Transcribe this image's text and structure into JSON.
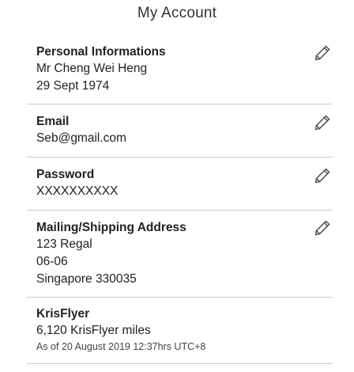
{
  "header": {
    "title": "My Account"
  },
  "personal": {
    "heading": "Personal Informations",
    "name": "Mr Cheng Wei Heng",
    "dob": "29 Sept 1974",
    "edit_icon": "pencil-icon"
  },
  "email": {
    "heading": "Email",
    "value": "Seb@gmail.com",
    "edit_icon": "pencil-icon"
  },
  "password": {
    "heading": "Password",
    "value": "XXXXXXXXXX",
    "edit_icon": "pencil-icon"
  },
  "address": {
    "heading": "Mailing/Shipping Address",
    "lines": [
      "123 Regal",
      "06-06",
      "Singapore 330035"
    ],
    "edit_icon": "pencil-icon"
  },
  "krisflyer": {
    "heading": "KrisFlyer",
    "miles": "6,120 KrisFlyer miles",
    "as_of": "As of 20 August 2019 12:37hrs UTC+8"
  },
  "colors": {
    "text": "#222222",
    "divider": "#c8c8c8",
    "icon": "#444444"
  }
}
